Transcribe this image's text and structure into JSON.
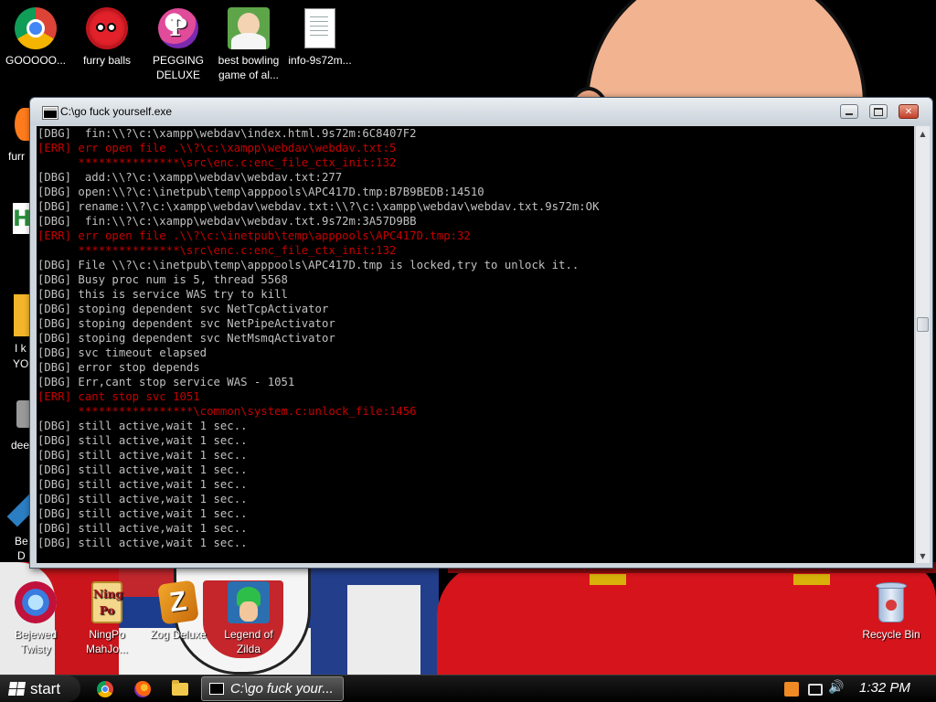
{
  "desktop": {
    "top_icons": [
      {
        "label": "GOOOOO..."
      },
      {
        "label": "furry balls"
      },
      {
        "label": "PEGGING DELUXE"
      },
      {
        "label": "best bowling game of al..."
      },
      {
        "label": "info-9s72m..."
      }
    ],
    "bottom_icons": [
      {
        "label": "Bejewed Twisty"
      },
      {
        "label": "NingPo MahJo..."
      },
      {
        "label": "Zog Deluxe"
      },
      {
        "label": "Legend of Zilda"
      }
    ],
    "recycle_bin": {
      "label": "Recycle Bin"
    },
    "partial_labels": [
      "furr",
      "I k",
      "YO",
      "dee",
      "Be",
      "D"
    ],
    "icon_glyphs": {
      "pegging": "P",
      "ningpo": "Ning Po",
      "zog": "Z"
    }
  },
  "window": {
    "title": "C:\\go fuck yourself.exe",
    "buttons": {
      "close": "✕"
    }
  },
  "console": {
    "lines": [
      {
        "text": "[DBG]  fin:\\\\?\\c:\\xampp\\webdav\\index.html.9s72m:6C8407F2",
        "kind": "dbg"
      },
      {
        "text": "[ERR] err open file .\\\\?\\c:\\xampp\\webdav\\webdav.txt:5",
        "kind": "err"
      },
      {
        "text": "      ***************\\src\\enc.c:enc_file_ctx_init:132",
        "kind": "err"
      },
      {
        "text": "[DBG]  add:\\\\?\\c:\\xampp\\webdav\\webdav.txt:277",
        "kind": "dbg"
      },
      {
        "text": "[DBG] open:\\\\?\\c:\\inetpub\\temp\\apppools\\APC417D.tmp:B7B9BEDB:14510",
        "kind": "dbg"
      },
      {
        "text": "[DBG] rename:\\\\?\\c:\\xampp\\webdav\\webdav.txt:\\\\?\\c:\\xampp\\webdav\\webdav.txt.9s72m:OK",
        "kind": "dbg"
      },
      {
        "text": "[DBG]  fin:\\\\?\\c:\\xampp\\webdav\\webdav.txt.9s72m:3A57D9BB",
        "kind": "dbg"
      },
      {
        "text": "[ERR] err open file .\\\\?\\c:\\inetpub\\temp\\apppools\\APC417D.tmp:32",
        "kind": "err"
      },
      {
        "text": "      ***************\\src\\enc.c:enc_file_ctx_init:132",
        "kind": "err"
      },
      {
        "text": "[DBG] File \\\\?\\c:\\inetpub\\temp\\apppools\\APC417D.tmp is locked,try to unlock it..",
        "kind": "dbg"
      },
      {
        "text": "[DBG] Busy proc num is 5, thread 5568",
        "kind": "dbg"
      },
      {
        "text": "[DBG] this is service WAS try to kill",
        "kind": "dbg"
      },
      {
        "text": "[DBG] stoping dependent svc NetTcpActivator",
        "kind": "dbg"
      },
      {
        "text": "[DBG] stoping dependent svc NetPipeActivator",
        "kind": "dbg"
      },
      {
        "text": "[DBG] stoping dependent svc NetMsmqActivator",
        "kind": "dbg"
      },
      {
        "text": "[DBG] svc timeout elapsed",
        "kind": "dbg"
      },
      {
        "text": "[DBG] error stop depends",
        "kind": "dbg"
      },
      {
        "text": "[DBG] Err,cant stop service WAS - 1051",
        "kind": "dbg"
      },
      {
        "text": "[ERR] cant stop svc 1051",
        "kind": "err"
      },
      {
        "text": "      *****************\\common\\system.c:unlock_file:1456",
        "kind": "err"
      },
      {
        "text": "[DBG] still active,wait 1 sec..",
        "kind": "dbg"
      },
      {
        "text": "[DBG] still active,wait 1 sec..",
        "kind": "dbg"
      },
      {
        "text": "[DBG] still active,wait 1 sec..",
        "kind": "dbg"
      },
      {
        "text": "[DBG] still active,wait 1 sec..",
        "kind": "dbg"
      },
      {
        "text": "[DBG] still active,wait 1 sec..",
        "kind": "dbg"
      },
      {
        "text": "[DBG] still active,wait 1 sec..",
        "kind": "dbg"
      },
      {
        "text": "[DBG] still active,wait 1 sec..",
        "kind": "dbg"
      },
      {
        "text": "[DBG] still active,wait 1 sec..",
        "kind": "dbg"
      },
      {
        "text": "[DBG] still active,wait 1 sec..",
        "kind": "dbg"
      }
    ],
    "colors": {
      "dbg": "#c0c0c0",
      "err": "#c40000"
    }
  },
  "taskbar": {
    "start_label": "start",
    "active_task": "C:\\go fuck your...",
    "tray_glyphs": {
      "volume": "🔊"
    },
    "clock": "1:32 PM"
  }
}
